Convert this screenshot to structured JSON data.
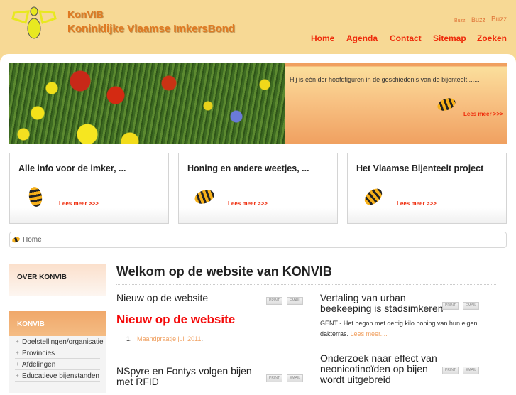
{
  "header": {
    "brand_short": "KonVIB",
    "brand_full": "Koninklijke Vlaamse ImkersBond",
    "buzz": [
      "Buzz",
      "Buzz",
      "Buzz"
    ],
    "nav": [
      "Home",
      "Agenda",
      "Contact",
      "Sitemap",
      "Zoeken"
    ]
  },
  "banner": {
    "text": "Hij is één der hoofdfiguren in de geschiedenis van de bijenteelt.......",
    "more": "Lees meer >>>"
  },
  "boxes": [
    {
      "title": "Alle info voor de imker, ...",
      "more": "Lees meer >>>"
    },
    {
      "title": "Honing en andere weetjes, ...",
      "more": "Lees meer >>>"
    },
    {
      "title": "Het Vlaamse Bijenteelt project",
      "more": "Lees meer >>>"
    }
  ],
  "breadcrumb": "Home",
  "sidebar": {
    "over": "OVER KONVIB",
    "konvib": "KONVIB",
    "items": [
      "Doelstellingen/organisatie",
      "Provincies",
      "Afdelingen",
      "Educatieve bijenstanden"
    ]
  },
  "main": {
    "title": "Welkom op de website van KONVIB",
    "print": "PRINT",
    "email": "EMAIL",
    "left": [
      {
        "title": "Nieuw op de website",
        "heading": "Nieuw op de website",
        "list_num": "1.",
        "link": "Maandpraatje juli 2011",
        "after": "."
      },
      {
        "title": "NSpyre en Fontys volgen bijen met RFID"
      }
    ],
    "right": [
      {
        "title": "Vertaling van urban beekeeping is stadsimkeren",
        "text": "GENT - Het begon met dertig kilo honing van hun eigen dakterras.",
        "more": "Lees meer...."
      },
      {
        "title": "Onderzoek naar effect van neonicotinoïden op bijen wordt uitgebreid"
      }
    ]
  }
}
